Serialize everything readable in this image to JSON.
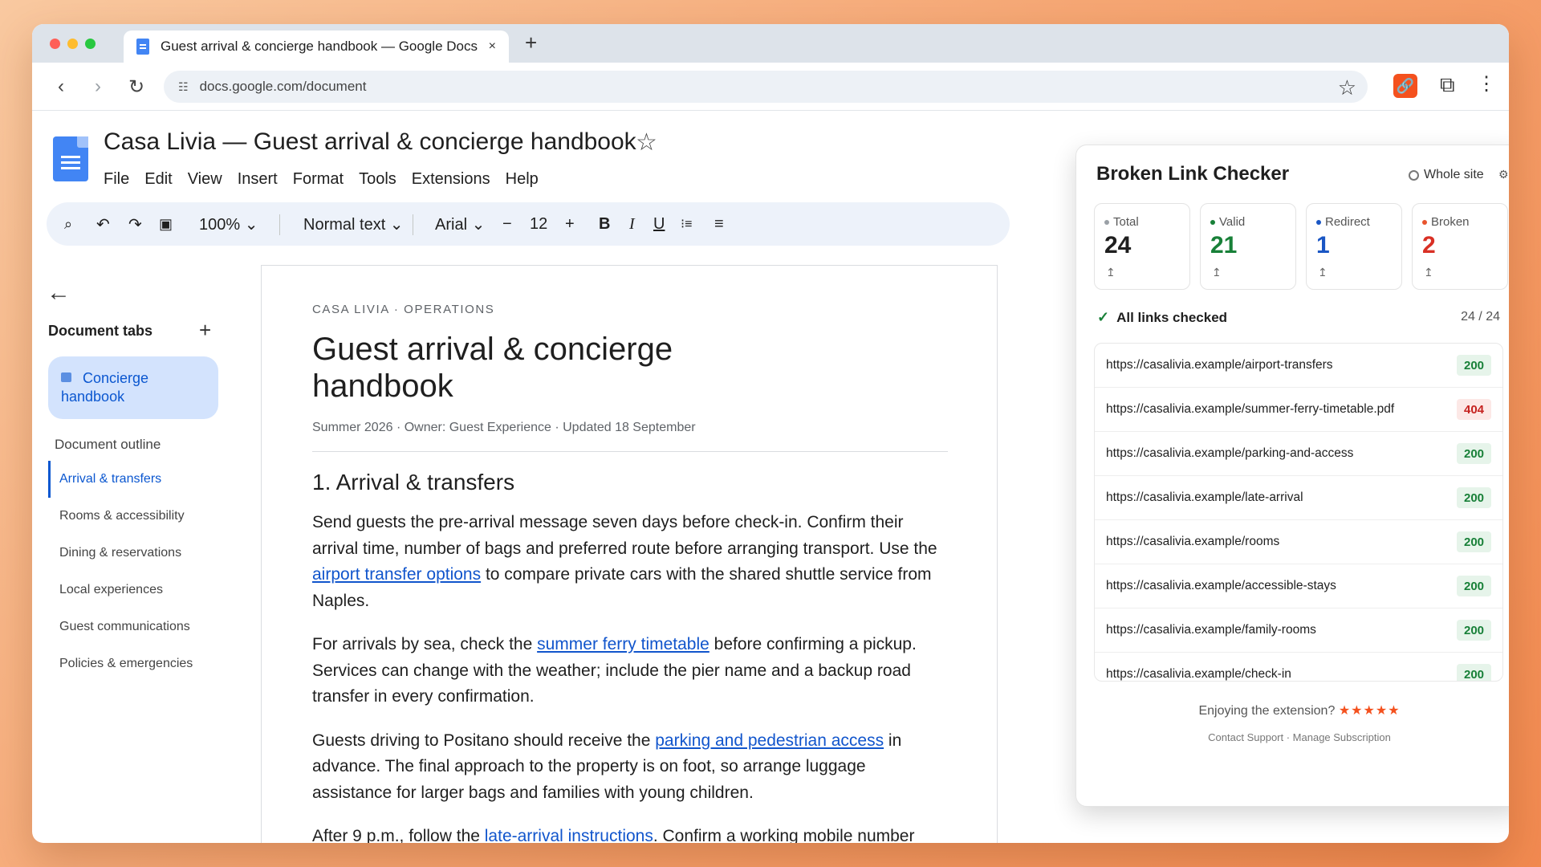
{
  "browser": {
    "tab_title": "Guest arrival & concierge handbook — Google Docs",
    "tab_close": "×",
    "new_tab": "+",
    "url": "docs.google.com/document",
    "back": "‹",
    "forward": "›",
    "reload": "↻",
    "bookmark_star": "☆",
    "extension_icon": "🔗",
    "puzzle_icon": "⧉",
    "menu_icon": "⋮"
  },
  "docs": {
    "title": "Casa Livia — Guest arrival & concierge handbook",
    "star": "☆",
    "menu": [
      "File",
      "Edit",
      "View",
      "Insert",
      "Format",
      "Tools",
      "Extensions",
      "Help"
    ],
    "format_bar": {
      "search": "⌕",
      "undo": "↶",
      "redo": "↷",
      "paint": "▣",
      "zoom": "100% ⌄",
      "style": "Normal text ⌄",
      "font": "Arial ⌄",
      "minus": "−",
      "size": "12",
      "plus": "+",
      "bold": "B",
      "italic": "I",
      "underline": "U",
      "checklist": "⁝≡",
      "align": "≡"
    }
  },
  "sidebar": {
    "back": "←",
    "heading": "Document tabs",
    "add": "+",
    "active_tab": "Concierge handbook",
    "outline_heading": "Document outline",
    "outline": [
      "Arrival & transfers",
      "Rooms & accessibility",
      "Dining & reservations",
      "Local experiences",
      "Guest communications",
      "Policies & emergencies"
    ]
  },
  "page": {
    "eyebrow": "CASA LIVIA · OPERATIONS",
    "heading": "Guest arrival & concierge handbook",
    "meta": "Summer 2026 · Owner: Guest Experience · Updated 18 September",
    "section": "1. Arrival & transfers",
    "p1": {
      "a": "Send guests the pre-arrival message seven days before check-in. Confirm their arrival time, number of bags and preferred route before arranging transport. Use the ",
      "link": "airport transfer options",
      "b": " to compare private cars with the shared shuttle service from Naples."
    },
    "p2": {
      "a": "For arrivals by sea, check the ",
      "link": "summer ferry timetable",
      "b": " before confirming a pickup. Services can change with the weather; include the pier name and a backup road transfer in every confirmation."
    },
    "p3": {
      "a": "Guests driving to Positano should receive the ",
      "link": "parking and pedestrian access",
      "b": " in advance. The final approach to the property is on foot, so arrange luggage assistance for larger bags and families with young children."
    },
    "p4": {
      "a": "After 9 p.m., follow the ",
      "link": "late-arrival instructions",
      "b": ". Confirm a working mobile number"
    }
  },
  "extension": {
    "title": "Broken Link Checker",
    "scope": "Whole site",
    "gear": "⚙",
    "stats": [
      {
        "label": "Total",
        "value": "24",
        "color": "#1f1f1f",
        "dot": "#9aa0a6"
      },
      {
        "label": "Valid",
        "value": "21",
        "color": "#188038",
        "dot": "#188038"
      },
      {
        "label": "Redirect",
        "value": "1",
        "color": "#1a56c4",
        "dot": "#1a56c4"
      },
      {
        "label": "Broken",
        "value": "2",
        "color": "#d93025",
        "dot": "#e8542e"
      }
    ],
    "stat_arrow": "↥",
    "status_check": "✓",
    "status": "All links checked",
    "progress": "24 / 24",
    "links": [
      {
        "url": "https://casalivia.example/airport-transfers",
        "code": "200",
        "ok": true
      },
      {
        "url": "https://casalivia.example/summer-ferry-timetable.pdf",
        "code": "404",
        "ok": false
      },
      {
        "url": "https://casalivia.example/parking-and-access",
        "code": "200",
        "ok": true
      },
      {
        "url": "https://casalivia.example/late-arrival",
        "code": "200",
        "ok": true
      },
      {
        "url": "https://casalivia.example/rooms",
        "code": "200",
        "ok": true
      },
      {
        "url": "https://casalivia.example/accessible-stays",
        "code": "200",
        "ok": true
      },
      {
        "url": "https://casalivia.example/family-rooms",
        "code": "200",
        "ok": true
      },
      {
        "url": "https://casalivia.example/check-in",
        "code": "200",
        "ok": true
      }
    ],
    "enjoy": "Enjoying the extension?",
    "stars": "★★★★★",
    "footer": "Contact Support · Manage Subscription"
  }
}
